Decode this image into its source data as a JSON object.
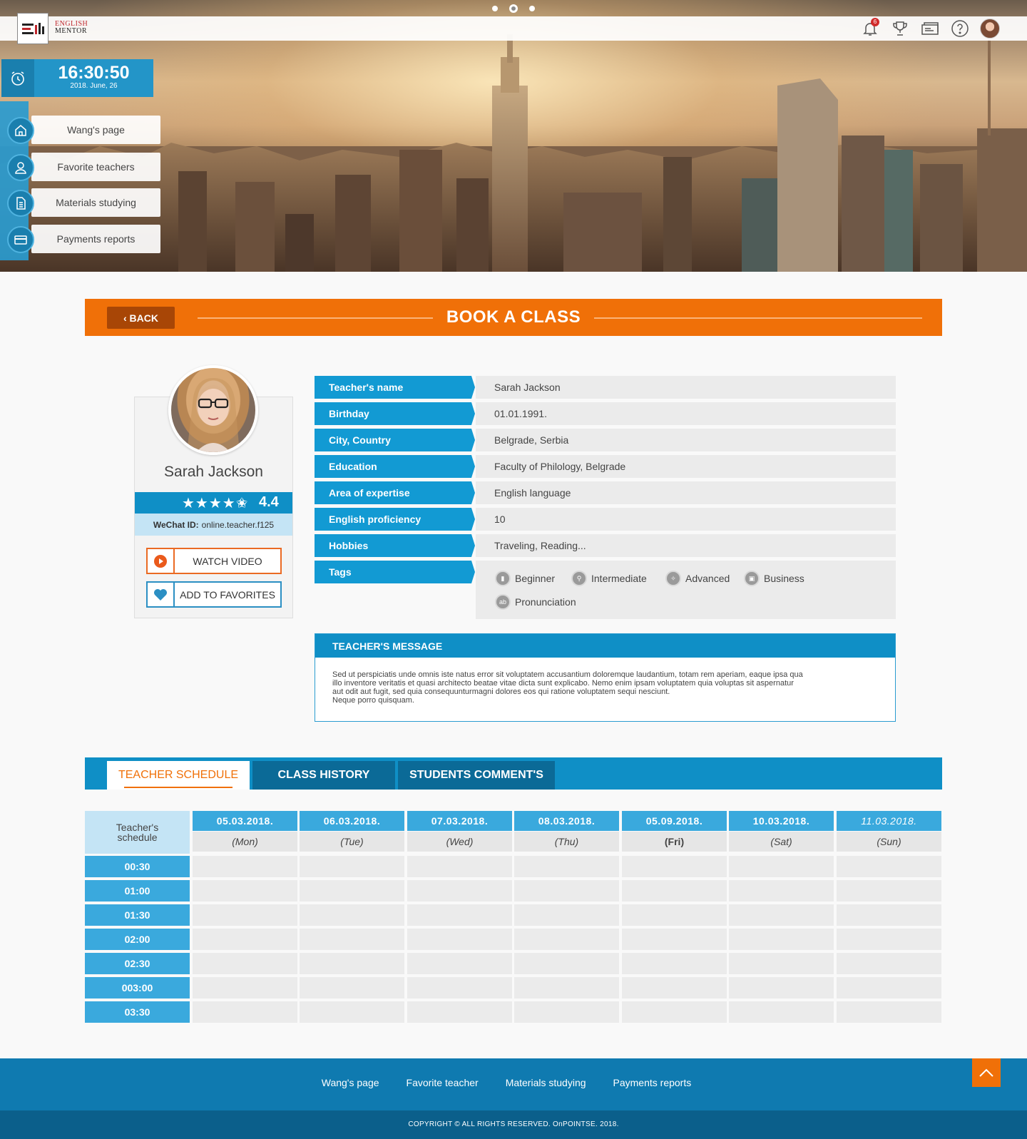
{
  "brand": {
    "line1": "ENGLISH",
    "line2": "MENTOR"
  },
  "header": {
    "notification_count": "6"
  },
  "clock": {
    "time": "16:30:50",
    "date": "2018. June, 26"
  },
  "sidebar": {
    "items": [
      {
        "label": "Wang's page",
        "icon": "home-icon"
      },
      {
        "label": "Favorite teachers",
        "icon": "user-icon"
      },
      {
        "label": "Materials studying",
        "icon": "document-icon"
      },
      {
        "label": "Payments reports",
        "icon": "credit-card-icon"
      }
    ]
  },
  "book": {
    "back_label": "BACK",
    "title": "BOOK A CLASS"
  },
  "teacher": {
    "name": "Sarah Jackson",
    "stars": "★★★★✬",
    "rating": "4.4",
    "wechat_label": "WeChat ID:",
    "wechat_id": "online.teacher.f125",
    "watch_video_label": "WATCH VIDEO",
    "add_favorites_label": "ADD TO FAVORITES"
  },
  "info": {
    "rows": [
      {
        "label": "Teacher's name",
        "value": "Sarah Jackson"
      },
      {
        "label": "Birthday",
        "value": "01.01.1991."
      },
      {
        "label": "City, Country",
        "value": "Belgrade, Serbia"
      },
      {
        "label": "Education",
        "value": "Faculty of Philology, Belgrade"
      },
      {
        "label": "Area of expertise",
        "value": "English language"
      },
      {
        "label": "English proficiency",
        "value": "10"
      },
      {
        "label": "Hobbies",
        "value": "Traveling, Reading..."
      }
    ],
    "tags_label": "Tags",
    "tags": [
      "Beginner",
      "Intermediate",
      "Advanced",
      "Business",
      "Pronunciation"
    ]
  },
  "message": {
    "title": "TEACHER'S MESSAGE",
    "lines": [
      "Sed ut perspiciatis unde omnis iste natus error sit voluptatem accusantium doloremque laudantium, totam rem aperiam, eaque ipsa qua",
      "illo inventore veritatis et quasi architecto beatae vitae dicta sunt explicabo. Nemo enim ipsam voluptatem quia voluptas sit aspernatur",
      "aut odit aut fugit, sed quia consequunturmagni dolores eos qui ratione voluptatem sequi nesciunt.",
      "Neque porro quisquam."
    ]
  },
  "tabs": [
    "TEACHER SCHEDULE",
    "CLASS HISTORY",
    "STUDENTS COMMENT'S"
  ],
  "schedule": {
    "corner_line1": "Teacher's",
    "corner_line2": "schedule",
    "days": [
      {
        "date": "05.03.2018.",
        "name": "(Mon)"
      },
      {
        "date": "06.03.2018.",
        "name": "(Tue)"
      },
      {
        "date": "07.03.2018.",
        "name": "(Wed)"
      },
      {
        "date": "08.03.2018.",
        "name": "(Thu)"
      },
      {
        "date": "05.09.2018.",
        "name": "(Fri)"
      },
      {
        "date": "10.03.2018.",
        "name": "(Sat)"
      },
      {
        "date": "11.03.2018.",
        "name": "(Sun)"
      }
    ],
    "times": [
      "00:30",
      "01:00",
      "01:30",
      "02:00",
      "02:30",
      "003:00",
      "03:30"
    ]
  },
  "footer": {
    "links": [
      "Wang's page",
      "Favorite teacher",
      "Materials studying",
      "Payments reports"
    ],
    "copyright": "COPYRIGHT © ALL RIGHTS RESERVED. OnPOINTSE. 2018."
  },
  "colors": {
    "orange": "#f07008",
    "blue": "#0f8fc6",
    "light_blue": "#3aa9dd",
    "dark_blue": "#0b5f8b"
  }
}
